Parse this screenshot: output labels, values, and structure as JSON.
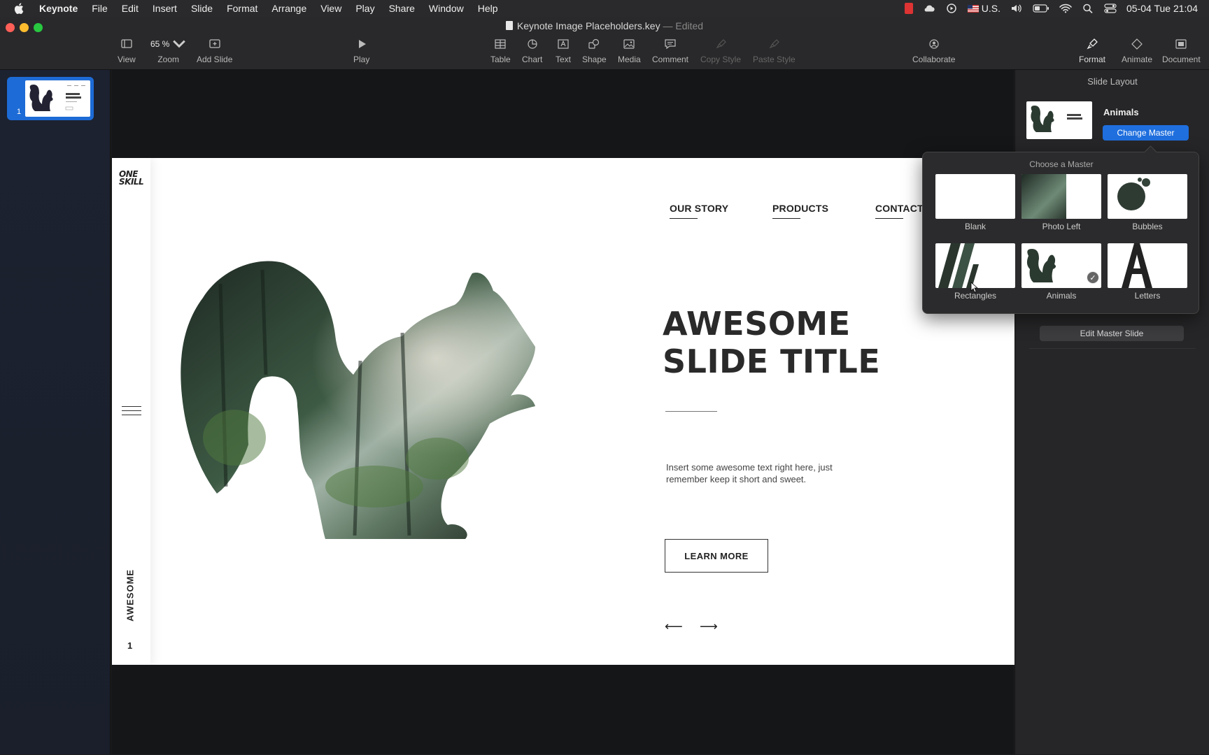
{
  "menubar": {
    "app": "Keynote",
    "items": [
      "File",
      "Edit",
      "Insert",
      "Slide",
      "Format",
      "Arrange",
      "View",
      "Play",
      "Share",
      "Window",
      "Help"
    ],
    "input_source": "U.S.",
    "clock": "05-04 Tue  21:04"
  },
  "window": {
    "doc_name": "Keynote Image Placeholders.key",
    "separator": "—",
    "doc_status": "Edited"
  },
  "toolbar": {
    "view": "View",
    "zoom_value": "65 %",
    "zoom": "Zoom",
    "add_slide": "Add Slide",
    "play": "Play",
    "table": "Table",
    "chart": "Chart",
    "text": "Text",
    "shape": "Shape",
    "media": "Media",
    "comment": "Comment",
    "copy_style": "Copy Style",
    "paste_style": "Paste Style",
    "collaborate": "Collaborate",
    "format": "Format",
    "animate": "Animate",
    "document": "Document"
  },
  "navigator": {
    "slide_number": "1"
  },
  "slide": {
    "logo_top": "ONE",
    "logo_bottom": "SKILL",
    "nav": [
      "OUR STORY",
      "PRODUCTS",
      "CONTACT"
    ],
    "title_line1": "AWESOME",
    "title_line2": "SLIDE TITLE",
    "body": "Insert some awesome text right here, just remember keep it short and sweet.",
    "button": "LEARN MORE",
    "vertical_word": "AWESOME",
    "page_number": "1",
    "arrow_left": "⟵",
    "arrow_right": "⟶"
  },
  "inspector": {
    "title": "Slide Layout",
    "master_name": "Animals",
    "change_master": "Change Master",
    "edit_master": "Edit Master Slide"
  },
  "popover": {
    "title": "Choose a Master",
    "masters": [
      "Blank",
      "Photo Left",
      "Bubbles",
      "Rectangles",
      "Animals",
      "Letters"
    ],
    "selected": "Animals",
    "check": "✓"
  }
}
